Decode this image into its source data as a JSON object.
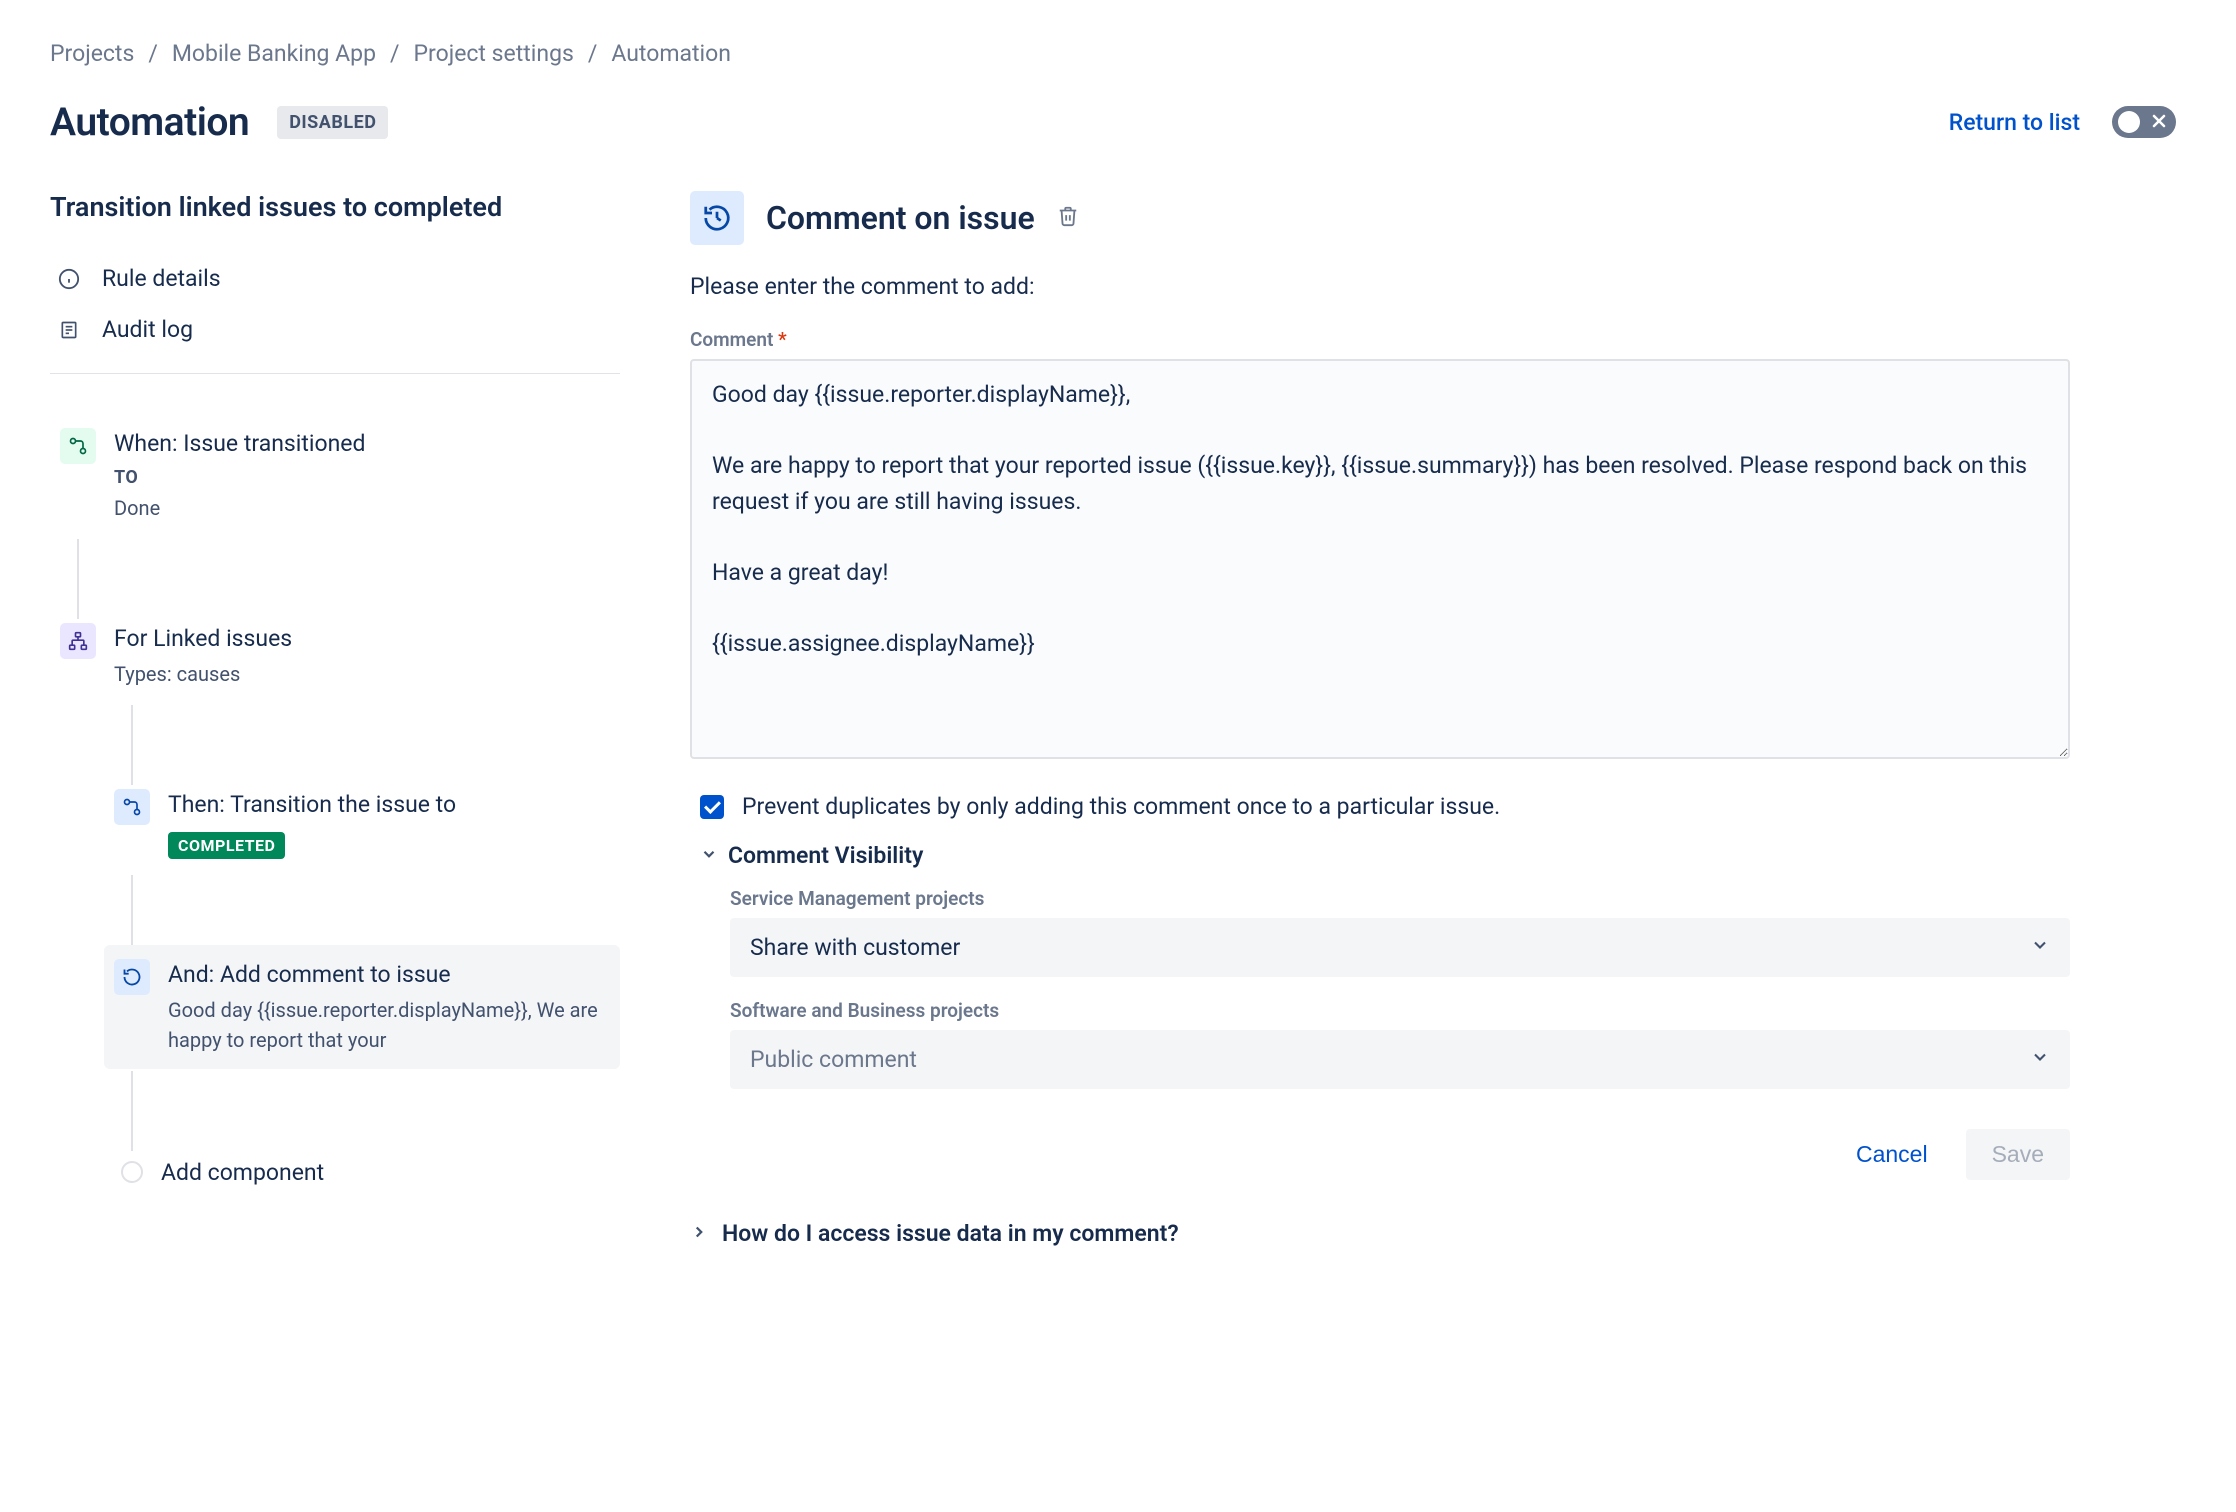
{
  "breadcrumb": [
    "Projects",
    "Mobile Banking App",
    "Project settings",
    "Automation"
  ],
  "header": {
    "title": "Automation",
    "status_badge": "DISABLED",
    "return_link": "Return to list"
  },
  "sidebar": {
    "rule_name": "Transition linked issues to completed",
    "nav": {
      "rule_details": "Rule details",
      "audit_log": "Audit log"
    },
    "chain": {
      "when": {
        "title": "When: Issue transitioned",
        "to_label": "TO",
        "to_value": "Done"
      },
      "for": {
        "title": "For Linked issues",
        "sub": "Types: causes"
      },
      "then": {
        "title": "Then: Transition the issue to",
        "badge": "COMPLETED"
      },
      "and": {
        "title": "And: Add comment to issue",
        "preview": "Good day {{issue.reporter.displayName}}, We are happy to report that your"
      },
      "add": "Add component"
    }
  },
  "panel": {
    "title": "Comment on issue",
    "instruction": "Please enter the comment to add:",
    "comment_label": "Comment",
    "comment_value": "Good day {{issue.reporter.displayName}},\n\nWe are happy to report that your reported issue ({{issue.key}}, {{issue.summary}}) has been resolved. Please respond back on this request if you are still having issues.\n\nHave a great day!\n\n{{issue.assignee.displayName}}",
    "prevent_dup": "Prevent duplicates by only adding this comment once to a particular issue.",
    "visibility": {
      "heading": "Comment Visibility",
      "sm_label": "Service Management projects",
      "sm_value": "Share with customer",
      "sw_label": "Software and Business projects",
      "sw_value": "Public comment"
    },
    "help": "How do I access issue data in my comment?",
    "cancel": "Cancel",
    "save": "Save"
  }
}
